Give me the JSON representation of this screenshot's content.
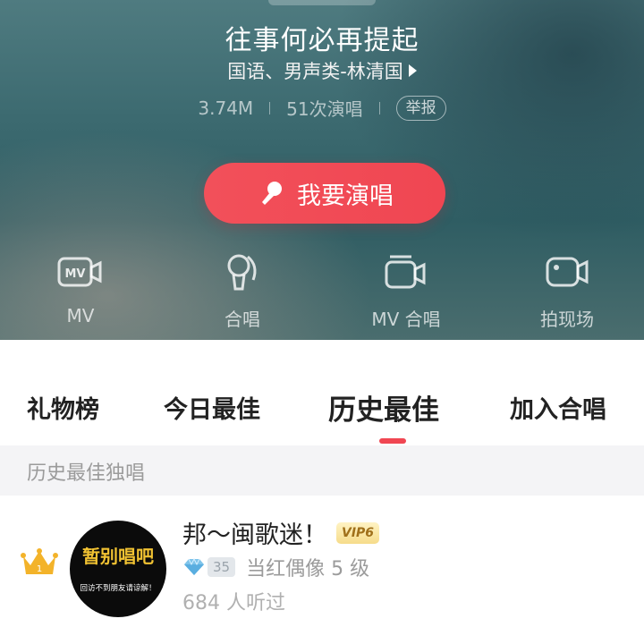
{
  "song": {
    "title": "往事何必再提起",
    "subtitle": "国语、男声类-林清国",
    "plays": "3.74M",
    "sing_count": "51次演唱",
    "report_label": "举报"
  },
  "sing_button": {
    "label": "我要演唱",
    "icon": "microphone-icon"
  },
  "actions": [
    {
      "label": "MV",
      "icon": "mv-camera-icon"
    },
    {
      "label": "合唱",
      "icon": "duet-mic-icon"
    },
    {
      "label": "MV 合唱",
      "icon": "mv-duet-camera-icon"
    },
    {
      "label": "拍现场",
      "icon": "video-camera-icon"
    }
  ],
  "tabs": [
    {
      "label": "礼物榜"
    },
    {
      "label": "今日最佳"
    },
    {
      "label": "历史最佳",
      "active": true
    },
    {
      "label": "加入合唱"
    }
  ],
  "section": {
    "title": "历史最佳独唱"
  },
  "entry": {
    "rank_icon": "crown-icon",
    "rank": "1",
    "avatar_text": "暂别唱吧",
    "avatar_subtext": "回访不到朋友请谅解！",
    "name": "邦～闽歌迷！",
    "vip_badge": "VIP6",
    "level_icon": "diamond-icon",
    "level_number": "35",
    "level_text": "当红偶像 5 级",
    "listeners": "684 人听过"
  },
  "colors": {
    "accent": "#f04652",
    "crown": "#f3b32a",
    "vip_badge": "#f6dc8a"
  }
}
